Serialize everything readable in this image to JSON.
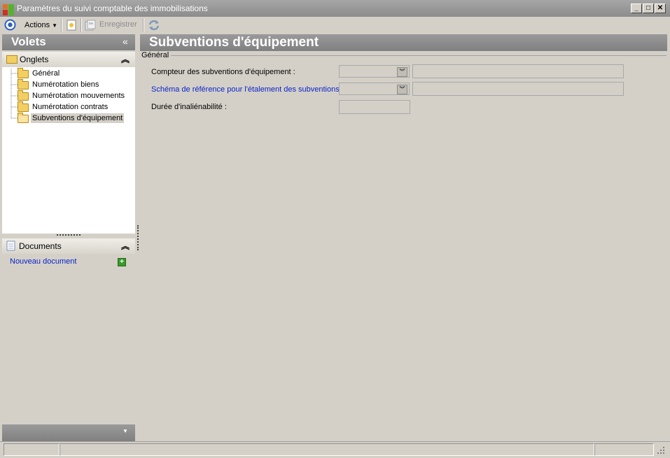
{
  "window": {
    "title": "Paramètres du suivi comptable des immobilisations",
    "controls": [
      "_",
      "□",
      "✕"
    ]
  },
  "toolbar": {
    "actions_label": "Actions",
    "save_label": "Enregistrer"
  },
  "left_pane": {
    "title": "Volets",
    "collapse_glyph": "«",
    "onglets": {
      "title": "Onglets",
      "items": [
        {
          "label": "Général",
          "selected": false
        },
        {
          "label": "Numérotation biens",
          "selected": false
        },
        {
          "label": "Numérotation mouvements",
          "selected": false
        },
        {
          "label": "Numérotation contrats",
          "selected": false
        },
        {
          "label": "Subventions d'équipement",
          "selected": true
        }
      ]
    },
    "documents": {
      "title": "Documents",
      "new_link": "Nouveau document"
    }
  },
  "main": {
    "title": "Subventions d'équipement",
    "group_label": "Général",
    "fields": [
      {
        "label": "Compteur des subventions d'équipement :",
        "type": "combo+text",
        "value": "",
        "link": false
      },
      {
        "label": "Schéma de référence pour l'étalement des subventions :",
        "type": "combo+text",
        "value": "",
        "link": true
      },
      {
        "label": "Durée d'inaliénabilité :",
        "type": "text",
        "value": "",
        "link": false
      }
    ]
  },
  "colors": {
    "link": "#0a24c8",
    "header_bg": "#8c8c8c",
    "window_bg": "#d4d0c8"
  }
}
